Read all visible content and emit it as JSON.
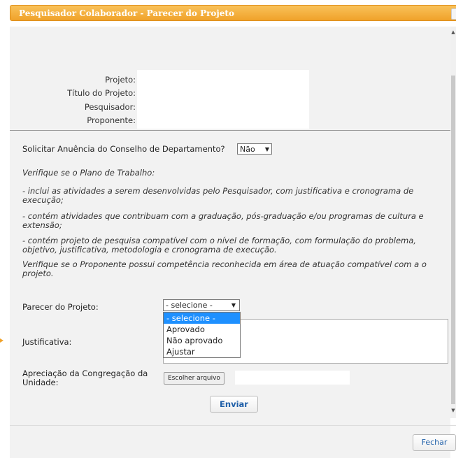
{
  "window": {
    "title": "Pesquisador Colaborador - Parecer do Projeto"
  },
  "info": {
    "projeto_label": "Projeto:",
    "titulo_label": "Título do Projeto:",
    "pesquisador_label": "Pesquisador:",
    "proponente_label": "Proponente:"
  },
  "anuencia": {
    "label": "Solicitar Anuência do Conselho de Departamento?",
    "value": "Não"
  },
  "instructions": {
    "intro": "Verifique se o Plano de Trabalho:",
    "item1": "- inclui as atividades a serem desenvolvidas pelo Pesquisador, com justificativa e cronograma de execução;",
    "item2": "- contém atividades que contribuam com a graduação, pós-graduação e/ou programas de cultura e extensão;",
    "item3": "- contém projeto de pesquisa compatível com o nível de formação, com formulação do problema, objetivo, justificativa, metodologia e cronograma de execução.",
    "item4": "Verifique se o Proponente possui competência reconhecida em área de atuação compatível com a o projeto."
  },
  "parecer": {
    "label": "Parecer do Projeto:",
    "selected": "- selecione -",
    "options": [
      "- selecione -",
      "Aprovado",
      "Não aprovado",
      "Ajustar"
    ]
  },
  "justificativa": {
    "label": "Justificativa:"
  },
  "apreciacao": {
    "label": "Apreciação da Congregação da Unidade:",
    "file_button": "Escolher arquivo"
  },
  "buttons": {
    "enviar": "Enviar",
    "fechar": "Fechar"
  }
}
